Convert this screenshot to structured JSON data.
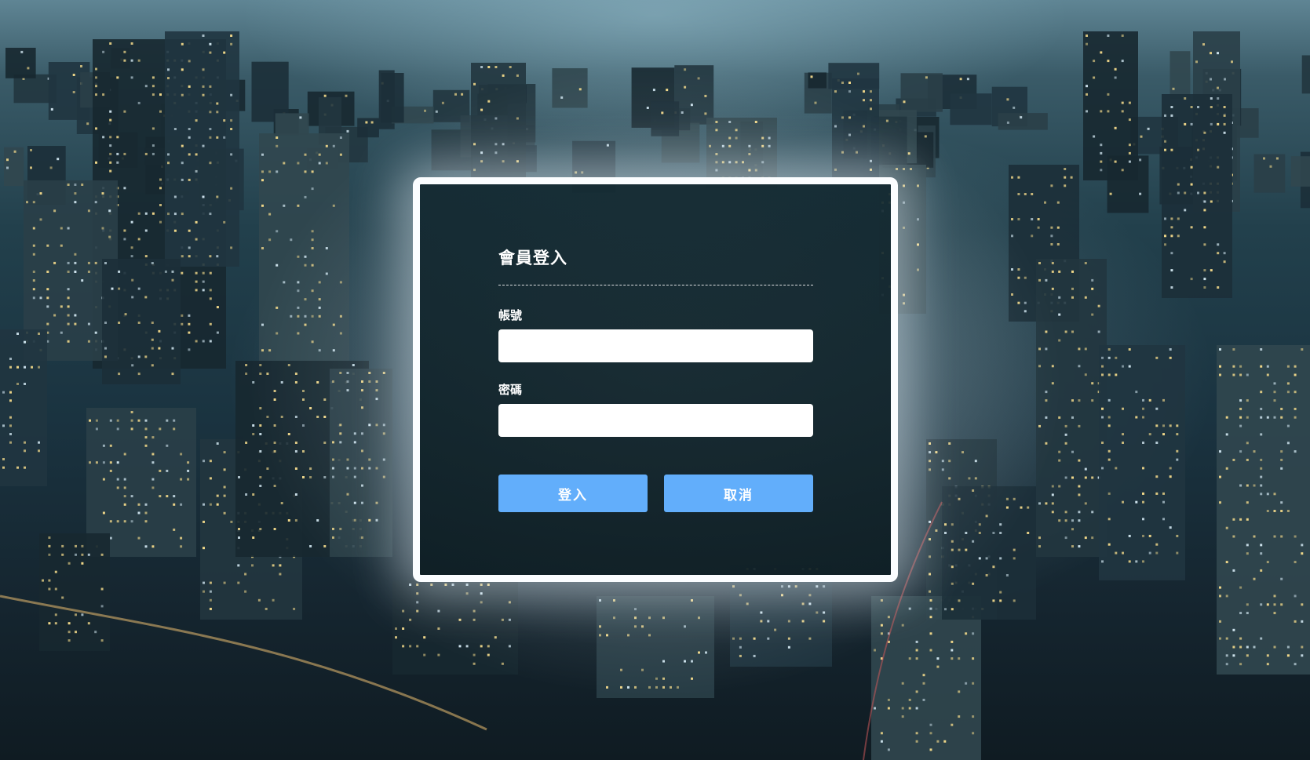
{
  "login": {
    "title": "會員登入",
    "account_label": "帳號",
    "account_value": "",
    "password_label": "密碼",
    "password_value": "",
    "submit_label": "登入",
    "cancel_label": "取消"
  },
  "colors": {
    "button_fill": "#62aefb",
    "card_border": "#fbfdff",
    "card_glass": "#12282f"
  },
  "background": {
    "description_icon": "city-skyline-photo"
  }
}
